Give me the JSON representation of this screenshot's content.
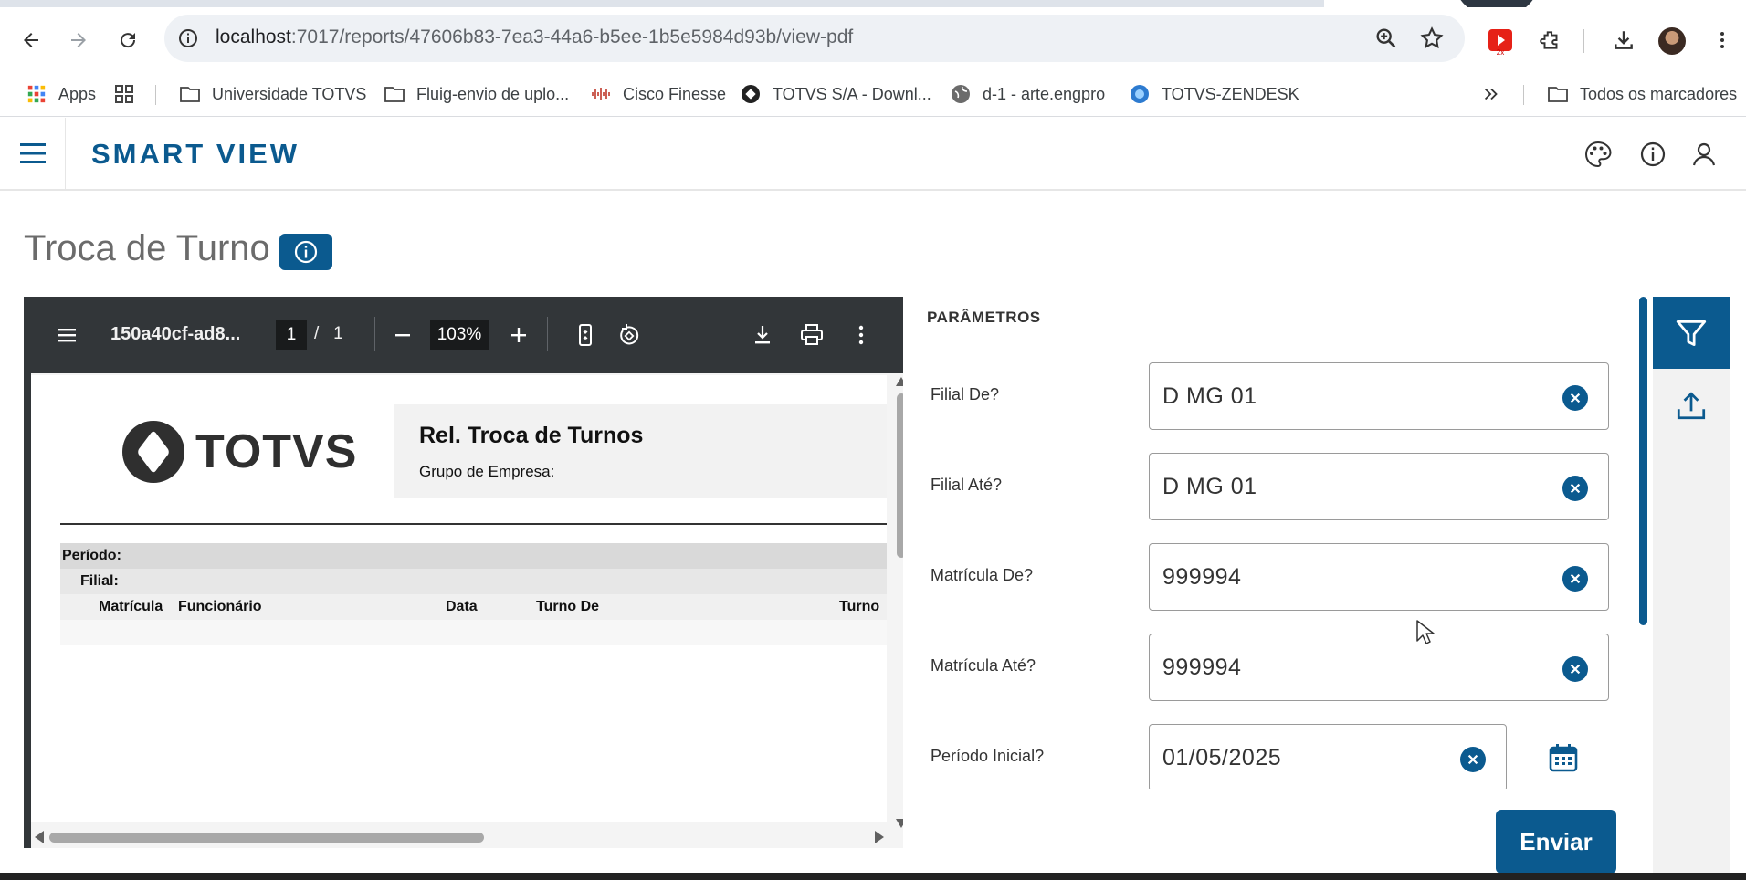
{
  "browser": {
    "url_host": "localhost",
    "url_path": ":7017/reports/47606b83-7ea3-44a6-b5ee-1b5e5984d93b/view-pdf",
    "bookmarks": [
      {
        "label": "Apps",
        "icon": "apps-grid-icon"
      },
      {
        "label": "Universidade TOTVS",
        "icon": "folder-icon"
      },
      {
        "label": "Fluig-envio de uplo...",
        "icon": "folder-icon"
      },
      {
        "label": "Cisco Finesse",
        "icon": "cisco-icon"
      },
      {
        "label": "TOTVS S/A - Downl...",
        "icon": "totvs-icon"
      },
      {
        "label": "d-1 - arte.engpro",
        "icon": "globe-icon"
      },
      {
        "label": "TOTVS-ZENDESK",
        "icon": "zendesk-icon"
      }
    ],
    "all_bookmarks_label": "Todos os marcadores"
  },
  "app": {
    "brand": "SMART VIEW",
    "page_title": "Troca de Turno"
  },
  "pdf": {
    "filename": "150a40cf-ad8...",
    "page_current": "1",
    "page_total": "/   1",
    "zoom": "103%",
    "report_logo": "TOTVS",
    "report_title": "Rel. Troca de Turnos",
    "report_subtitle": "Grupo de Empresa:",
    "period_label": "Período:",
    "filial_label": "Filial:",
    "columns": [
      "Matrícula",
      "Funcionário",
      "Data",
      "Turno De",
      "Turno"
    ]
  },
  "params": {
    "title": "PARÂMETROS",
    "fields": [
      {
        "label": "Filial De?",
        "value": "D MG 01"
      },
      {
        "label": "Filial Até?",
        "value": "D MG 01"
      },
      {
        "label": "Matrícula De?",
        "value": "999994"
      },
      {
        "label": "Matrícula Até?",
        "value": "999994"
      },
      {
        "label": "Período Inicial?",
        "value": "01/05/2025"
      }
    ],
    "submit_label": "Enviar"
  },
  "colors": {
    "primary": "#0b5a8f",
    "pdf_toolbar": "#323639"
  }
}
